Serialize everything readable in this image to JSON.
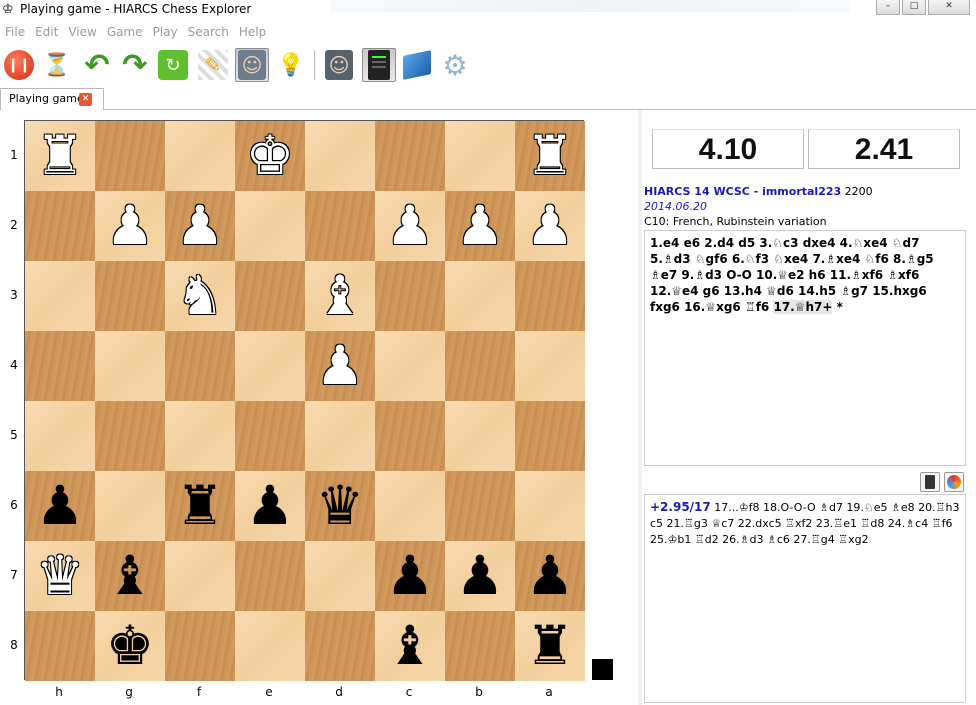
{
  "window": {
    "title": "Playing game - HIARCS Chess Explorer",
    "controls": [
      "–",
      "□",
      "✕"
    ]
  },
  "menu": [
    "File",
    "Edit",
    "View",
    "Game",
    "Play",
    "Search",
    "Help"
  ],
  "toolbar": {
    "icons": [
      "pause-icon",
      "hourglass-icon",
      "undo-icon",
      "redo-icon",
      "recycle-icon",
      "pencil-icon",
      "player-icon",
      "lightbulb-icon",
      "engine-player-icon",
      "engine-server-icon",
      "book-icon",
      "settings-icon"
    ],
    "glyphs": {
      "pause": "❙❙",
      "hourglass": "⏳",
      "undo": "↶",
      "redo": "↷",
      "recycle": "↻",
      "pencil": "✎",
      "player": "☺",
      "lightbulb": "💡",
      "engine_player": "☺",
      "gear": "⚙"
    }
  },
  "tab": {
    "label": "Playing game",
    "close": "✕"
  },
  "board": {
    "flipped": true,
    "files": [
      "h",
      "g",
      "f",
      "e",
      "d",
      "c",
      "b",
      "a"
    ],
    "ranks": [
      "1",
      "2",
      "3",
      "4",
      "5",
      "6",
      "7",
      "8"
    ],
    "squares": [
      [
        "R",
        "",
        "",
        "K",
        "",
        "",
        "",
        "R"
      ],
      [
        "",
        "P",
        "P",
        "",
        "",
        "P",
        "P",
        "P"
      ],
      [
        "",
        "",
        "N",
        "",
        "B",
        "",
        "",
        ""
      ],
      [
        "",
        "",
        "",
        "",
        "P",
        "",
        "",
        ""
      ],
      [
        "",
        "",
        "",
        "",
        "",
        "",
        "",
        ""
      ],
      [
        "p",
        "",
        "r",
        "p",
        "q",
        "",
        "",
        ""
      ],
      [
        "Q",
        "b",
        "",
        "",
        "",
        "p",
        "p",
        "p"
      ],
      [
        "",
        "k",
        "",
        "",
        "",
        "b",
        "",
        "r"
      ]
    ],
    "side_to_move": "black"
  },
  "clocks": {
    "white": "4.10",
    "black": "2.41"
  },
  "game": {
    "players": "HIARCS 14 WCSC - immortal223",
    "rating": "2200",
    "date": "2014.06.20",
    "opening": "C10: French, Rubinstein variation",
    "moves": "1.e4 e6 2.d4 d5 3.♘c3 dxe4 4.♘xe4 ♘d7 5.♗d3 ♘gf6 6.♘f3 ♘xe4 7.♗xe4 ♘f6 8.♗g5 ♗e7 9.♗d3 O-O 10.♕e2 h6 11.♗xf6 ♗xf6 12.♕e4 g6 13.h4 ♕d6 14.h5 ♗g7 15.hxg6 fxg6 16.♕xg6 ♖f6",
    "last_move": "17.♕h7+",
    "result": "*"
  },
  "analysis": {
    "score": "+2.95/17",
    "line": "17...♔f8 18.O-O-O ♗d7 19.♘e5 ♗e8 20.♖h3 c5 21.♖g3 ♕c7 22.dxc5 ♖xf2 23.♖e1 ♖d8 24.♗c4 ♖f6 25.♔b1 ♖d2 26.♗d3 ♗c6 27.♖g4 ♖xg2",
    "buttons": [
      "engine-icon",
      "color-wheel-icon"
    ]
  }
}
